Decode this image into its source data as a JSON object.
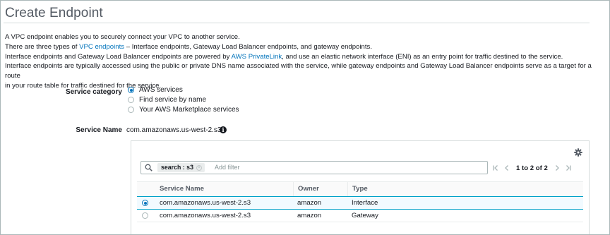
{
  "page": {
    "title": "Create Endpoint"
  },
  "description": {
    "line1": "A VPC endpoint enables you to securely connect your VPC to another service.",
    "line2_pre": "There are three types of ",
    "line2_link": "VPC endpoints",
    "line2_post": " – Interface endpoints, Gateway Load Balancer endpoints, and gateway endpoints.",
    "line3_pre": "Interface endpoints and Gateway Load Balancer endpoints are powered by ",
    "line3_link": "AWS PrivateLink",
    "line3_post": ", and use an elastic network interface (ENI) as an entry point for traffic destined to the service.",
    "line4": "Interface endpoints are typically accessed using the public or private DNS name associated with the service, while gateway endpoints and Gateway Load Balancer endpoints serve as a target for a route",
    "line5": "in your route table for traffic destined for the service."
  },
  "service_category": {
    "label": "Service category",
    "options": [
      {
        "label": "AWS services",
        "selected": true
      },
      {
        "label": "Find service by name",
        "selected": false
      },
      {
        "label": "Your AWS Marketplace services",
        "selected": false
      }
    ]
  },
  "service_name": {
    "label": "Service Name",
    "value": "com.amazonaws.us-west-2.s3",
    "info_icon": "info-icon"
  },
  "filter": {
    "token_key": "search : s3",
    "placeholder": "Add filter"
  },
  "pagination": {
    "text": "1 to 2 of 2"
  },
  "table": {
    "columns": [
      "Service Name",
      "Owner",
      "Type"
    ],
    "rows": [
      {
        "selected": true,
        "service_name": "com.amazonaws.us-west-2.s3",
        "owner": "amazon",
        "type": "Interface"
      },
      {
        "selected": false,
        "service_name": "com.amazonaws.us-west-2.s3",
        "owner": "amazon",
        "type": "Gateway"
      }
    ]
  },
  "colors": {
    "accent": "#0073bb",
    "selected_row_bg": "#f1faff",
    "selected_row_border": "#00a1c9"
  }
}
